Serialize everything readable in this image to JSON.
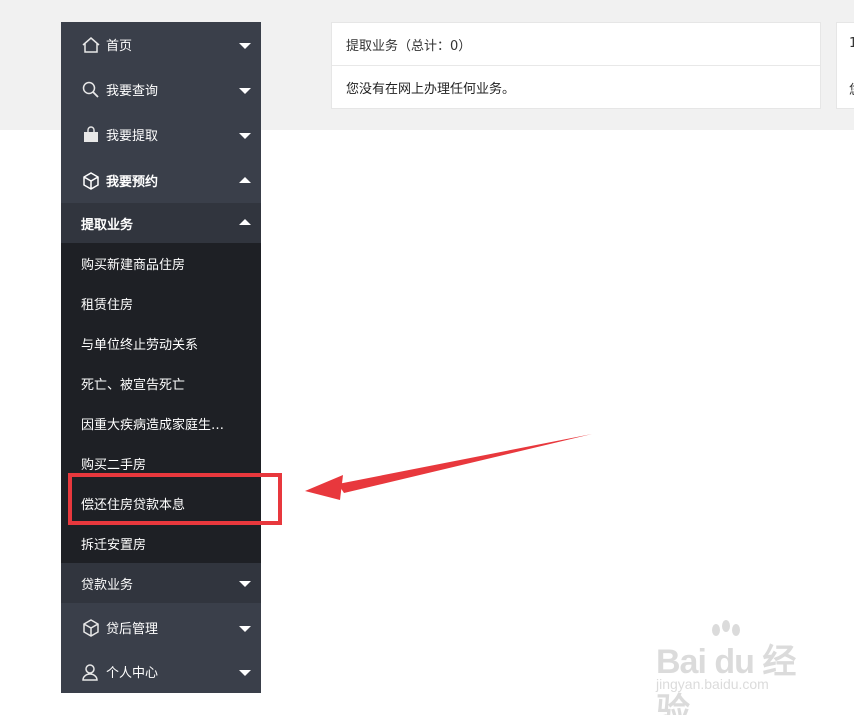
{
  "sidebar": {
    "items": [
      {
        "label": "首页",
        "icon": "home-icon"
      },
      {
        "label": "我要查询",
        "icon": "search-icon"
      },
      {
        "label": "我要提取",
        "icon": "shopping-bag-icon"
      },
      {
        "label": "我要预约",
        "icon": "cube-icon"
      }
    ],
    "submenu_header": "提取业务",
    "submenu_items": [
      "购买新建商品住房",
      "租赁住房",
      "与单位终止劳动关系",
      "死亡、被宣告死亡",
      "因重大疾病造成家庭生…",
      "购买二手房",
      "偿还住房贷款本息",
      "拆迁安置房"
    ],
    "loan_header": "贷款业务",
    "bottom_items": [
      {
        "label": "贷后管理",
        "icon": "cube-icon"
      },
      {
        "label": "个人中心",
        "icon": "user-icon"
      }
    ]
  },
  "panel": {
    "title": "提取业务（总计：0）",
    "message": "您没有在网上办理任何业务。"
  },
  "panel2": {
    "title_fragment": "1",
    "body_fragment": "您"
  },
  "watermark": {
    "brand": "Bai du 经验",
    "url": "jingyan.baidu.com"
  },
  "colors": {
    "sidebar_bg": "#3a3f4a",
    "submenu_header_bg": "#31353e",
    "submenu_bg": "#1e2025",
    "highlight": "#e8383d",
    "page_band": "#f1f1f1"
  }
}
